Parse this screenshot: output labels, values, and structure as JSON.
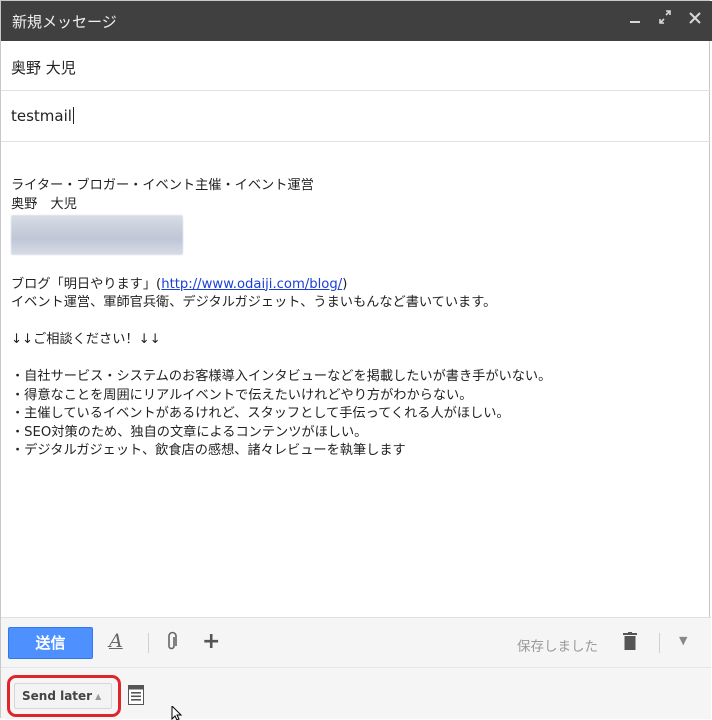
{
  "window": {
    "title": "新規メッセージ",
    "controls": [
      "minimize-icon",
      "expand-icon",
      "close-icon"
    ]
  },
  "to": {
    "value": "奥野 大児"
  },
  "subject": {
    "value": "testmail"
  },
  "body": {
    "lines_top": [
      "ライター・ブロガー・イベント主催・イベント運営",
      "奥野　大児"
    ],
    "blog_prefix": "ブログ「明日やります」(",
    "blog_link": "http://www.odaiji.com/blog/",
    "blog_suffix": ")",
    "line_after_blog": "イベント運営、軍師官兵衛、デジタルガジェット、うまいもんなど書いています。",
    "consult": "↓↓ご相談ください！↓↓",
    "bullets": [
      "・自社サービス・システムのお客様導入インタビューなどを掲載したいが書き手がいない。",
      "・得意なことを周囲にリアルイベントで伝えたいけれどやり方がわからない。",
      "・主催しているイベントがあるけれど、スタッフとして手伝ってくれる人がほしい。",
      "・SEO対策のため、独自の文章によるコンテンツがほしい。",
      "・デジタルガジェット、飲食店の感想、諸々レビューを執筆します"
    ]
  },
  "toolbar": {
    "send_label": "送信",
    "format_icon": "text-format-icon",
    "attach_icon": "paperclip-icon",
    "more_options_icon": "plus-icon",
    "saved_status": "保存しました",
    "discard_icon": "trash-icon",
    "more_icon": "chevron-down-icon",
    "send_color": "#4d90fe"
  },
  "bottom": {
    "send_later_label": "Send later",
    "note_icon": "notes-icon",
    "highlight_color": "#e0252a"
  }
}
